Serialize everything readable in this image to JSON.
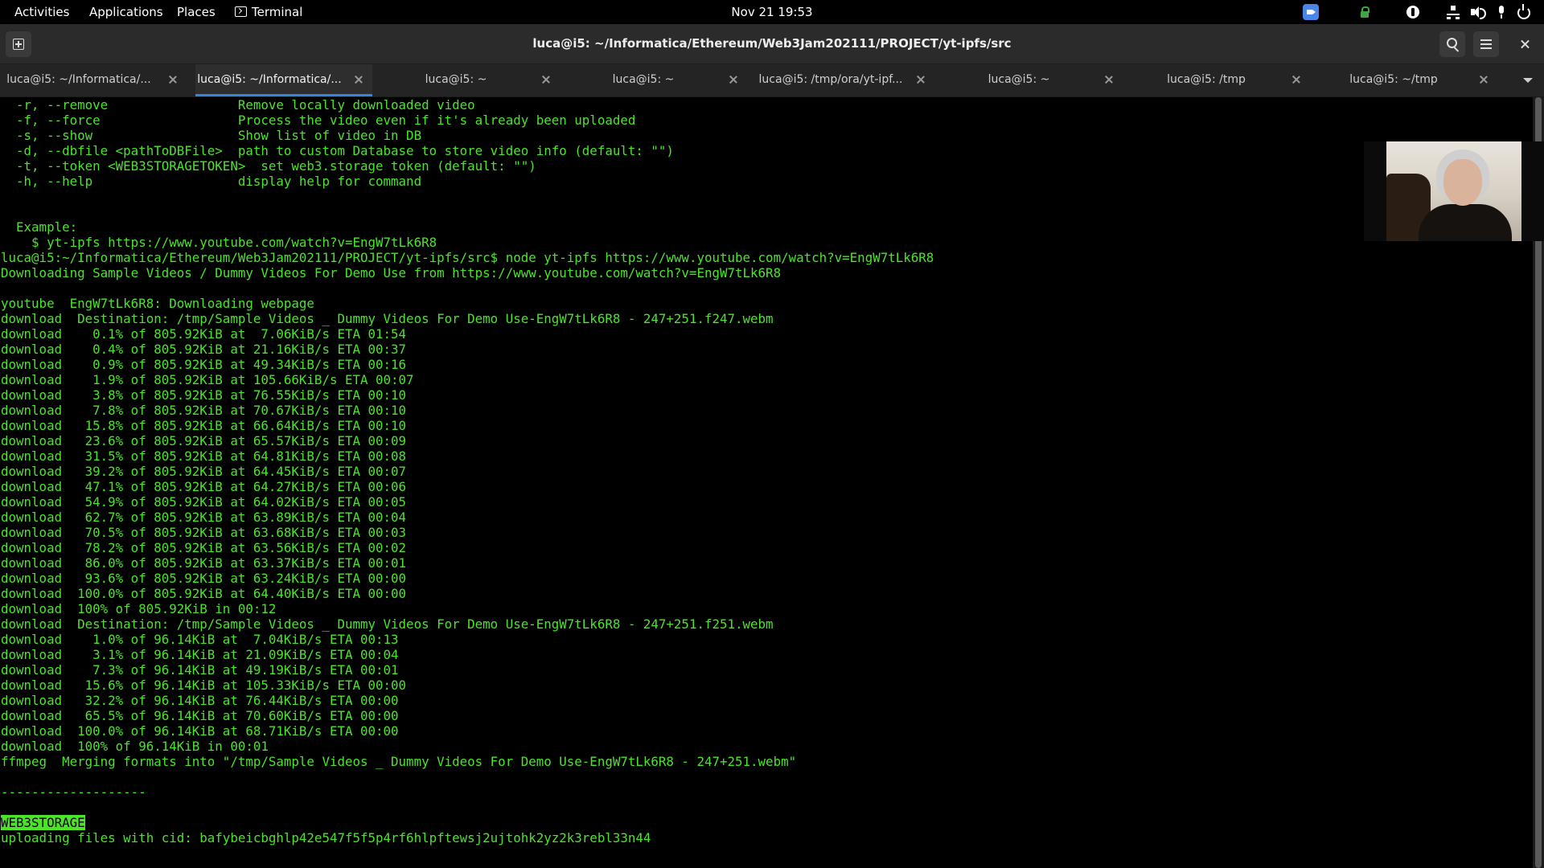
{
  "topbar": {
    "activities": "Activities",
    "applications": "Applications",
    "places": "Places",
    "terminal": "Terminal",
    "clock": "Nov 21  19:53"
  },
  "window": {
    "title": "luca@i5: ~/Informatica/Ethereum/Web3Jam202111/PROJECT/yt-ipfs/src"
  },
  "tabs": [
    {
      "label": "luca@i5: ~/Informatica/...",
      "active": false
    },
    {
      "label": "luca@i5: ~/Informatica/...",
      "active": true
    },
    {
      "label": "luca@i5: ~",
      "active": false
    },
    {
      "label": "luca@i5: ~",
      "active": false
    },
    {
      "label": "luca@i5: /tmp/ora/yt-ipf...",
      "active": false
    },
    {
      "label": "luca@i5: ~",
      "active": false
    },
    {
      "label": "luca@i5: /tmp",
      "active": false
    },
    {
      "label": "luca@i5: ~/tmp",
      "active": false
    }
  ],
  "terminal": {
    "lines": [
      "  -r, --remove                 Remove locally downloaded video",
      "  -f, --force                  Process the video even if it's already been uploaded",
      "  -s, --show                   Show list of video in DB",
      "  -d, --dbfile <pathToDBFile>  path to custom Database to store video info (default: \"\")",
      "  -t, --token <WEB3STORAGETOKEN>  set web3.storage token (default: \"\")",
      "  -h, --help                   display help for command",
      "",
      "",
      "  Example:",
      "    $ yt-ipfs https://www.youtube.com/watch?v=EngW7tLk6R8",
      "luca@i5:~/Informatica/Ethereum/Web3Jam202111/PROJECT/yt-ipfs/src$ node yt-ipfs https://www.youtube.com/watch?v=EngW7tLk6R8",
      "Downloading Sample Videos / Dummy Videos For Demo Use from https://www.youtube.com/watch?v=EngW7tLk6R8",
      "",
      "youtube  EngW7tLk6R8: Downloading webpage",
      "download  Destination: /tmp/Sample Videos _ Dummy Videos For Demo Use-EngW7tLk6R8 - 247+251.f247.webm",
      "download    0.1% of 805.92KiB at  7.06KiB/s ETA 01:54",
      "download    0.4% of 805.92KiB at 21.16KiB/s ETA 00:37",
      "download    0.9% of 805.92KiB at 49.34KiB/s ETA 00:16",
      "download    1.9% of 805.92KiB at 105.66KiB/s ETA 00:07",
      "download    3.8% of 805.92KiB at 76.55KiB/s ETA 00:10",
      "download    7.8% of 805.92KiB at 70.67KiB/s ETA 00:10",
      "download   15.8% of 805.92KiB at 66.64KiB/s ETA 00:10",
      "download   23.6% of 805.92KiB at 65.57KiB/s ETA 00:09",
      "download   31.5% of 805.92KiB at 64.81KiB/s ETA 00:08",
      "download   39.2% of 805.92KiB at 64.45KiB/s ETA 00:07",
      "download   47.1% of 805.92KiB at 64.27KiB/s ETA 00:06",
      "download   54.9% of 805.92KiB at 64.02KiB/s ETA 00:05",
      "download   62.7% of 805.92KiB at 63.89KiB/s ETA 00:04",
      "download   70.5% of 805.92KiB at 63.68KiB/s ETA 00:03",
      "download   78.2% of 805.92KiB at 63.56KiB/s ETA 00:02",
      "download   86.0% of 805.92KiB at 63.37KiB/s ETA 00:01",
      "download   93.6% of 805.92KiB at 63.24KiB/s ETA 00:00",
      "download  100.0% of 805.92KiB at 64.40KiB/s ETA 00:00",
      "download  100% of 805.92KiB in 00:12",
      "download  Destination: /tmp/Sample Videos _ Dummy Videos For Demo Use-EngW7tLk6R8 - 247+251.f251.webm",
      "download    1.0% of 96.14KiB at  7.04KiB/s ETA 00:13",
      "download    3.1% of 96.14KiB at 21.09KiB/s ETA 00:04",
      "download    7.3% of 96.14KiB at 49.19KiB/s ETA 00:01",
      "download   15.6% of 96.14KiB at 105.33KiB/s ETA 00:00",
      "download   32.2% of 96.14KiB at 76.44KiB/s ETA 00:00",
      "download   65.5% of 96.14KiB at 70.60KiB/s ETA 00:00",
      "download  100.0% of 96.14KiB at 68.71KiB/s ETA 00:00",
      "download  100% of 96.14KiB in 00:01",
      "ffmpeg  Merging formats into \"/tmp/Sample Videos _ Dummy Videos For Demo Use-EngW7tLk6R8 - 247+251.webm\"",
      "",
      "-------------------",
      "",
      "",
      "uploading files with cid: bafybeicbghlp42e547f5f5p4rf6hlpftewsj2ujtohk2yz2k3rebl33n44"
    ],
    "selected_text": "WEB3STORAGE",
    "selected_line_index": 47
  },
  "colors": {
    "terminal_fg": "#4ce32b",
    "terminal_bg": "#000000",
    "tab_accent": "#3584e4"
  },
  "icons": {
    "topbar_tray": [
      "zoom-icon",
      "lock-icon",
      "accessibility-icon",
      "network-icon",
      "volume-icon",
      "microphone-icon",
      "power-icon"
    ],
    "headerbar": [
      "new-tab-icon",
      "search-icon",
      "hamburger-menu-icon",
      "close-icon"
    ]
  }
}
